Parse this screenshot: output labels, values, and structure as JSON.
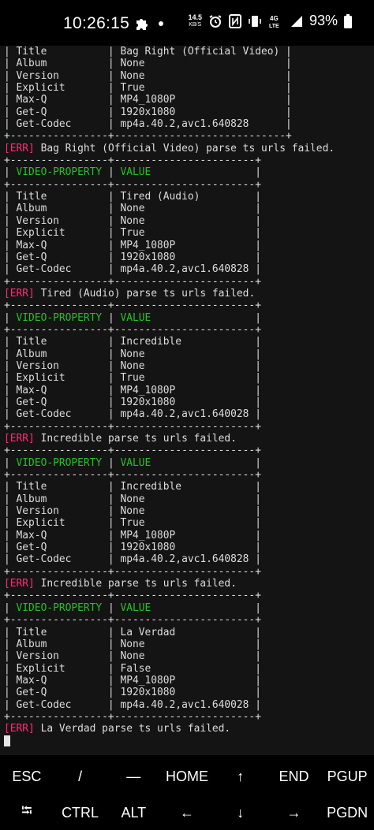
{
  "status_bar": {
    "time": "10:26:15",
    "net_speed_value": "14.5",
    "net_speed_unit": "KB/S",
    "network_type": "4G LTE",
    "battery": "93%",
    "icons": [
      "puzzle-icon",
      "dot-icon",
      "alarm-icon",
      "nfc-icon",
      "vibrate-icon",
      "signal-icon",
      "battery-icon"
    ]
  },
  "terminal": {
    "lines": [
      {
        "text": "| Title          | Bag Right (Official Video) |"
      },
      {
        "text": "| Album          | None                       |"
      },
      {
        "text": "| Version        | None                       |"
      },
      {
        "text": "| Explicit       | True                       |"
      },
      {
        "text": "| Max-Q          | MP4_1080P                  |"
      },
      {
        "text": "| Get-Q          | 1920x1080                  |"
      },
      {
        "text": "| Get-Codec      | mp4a.40.2,avc1.640828      |"
      },
      {
        "text": "+----------------+----------------------------+"
      },
      {
        "err": "[ERR]",
        "text": " Bag Right (Official Video) parse ts urls failed."
      },
      {
        "text": "+----------------+-----------------------+"
      },
      {
        "hdr": true,
        "text": "| VIDEO-PROPERTY | VALUE                 |"
      },
      {
        "text": "+----------------+-----------------------+"
      },
      {
        "text": "| Title          | Tired (Audio)         |"
      },
      {
        "text": "| Album          | None                  |"
      },
      {
        "text": "| Version        | None                  |"
      },
      {
        "text": "| Explicit       | True                  |"
      },
      {
        "text": "| Max-Q          | MP4_1080P             |"
      },
      {
        "text": "| Get-Q          | 1920x1080             |"
      },
      {
        "text": "| Get-Codec      | mp4a.40.2,avc1.640828 |"
      },
      {
        "text": "+----------------+-----------------------+"
      },
      {
        "err": "[ERR]",
        "text": " Tired (Audio) parse ts urls failed."
      },
      {
        "text": "+----------------+-----------------------+"
      },
      {
        "hdr": true,
        "text": "| VIDEO-PROPERTY | VALUE                 |"
      },
      {
        "text": "+----------------+-----------------------+"
      },
      {
        "text": "| Title          | Incredible            |"
      },
      {
        "text": "| Album          | None                  |"
      },
      {
        "text": "| Version        | None                  |"
      },
      {
        "text": "| Explicit       | True                  |"
      },
      {
        "text": "| Max-Q          | MP4_1080P             |"
      },
      {
        "text": "| Get-Q          | 1920x1080             |"
      },
      {
        "text": "| Get-Codec      | mp4a.40.2,avc1.640028 |"
      },
      {
        "text": "+----------------+-----------------------+"
      },
      {
        "err": "[ERR]",
        "text": " Incredible parse ts urls failed."
      },
      {
        "text": "+----------------+-----------------------+"
      },
      {
        "hdr": true,
        "text": "| VIDEO-PROPERTY | VALUE                 |"
      },
      {
        "text": "+----------------+-----------------------+"
      },
      {
        "text": "| Title          | Incredible            |"
      },
      {
        "text": "| Album          | None                  |"
      },
      {
        "text": "| Version        | None                  |"
      },
      {
        "text": "| Explicit       | True                  |"
      },
      {
        "text": "| Max-Q          | MP4_1080P             |"
      },
      {
        "text": "| Get-Q          | 1920x1080             |"
      },
      {
        "text": "| Get-Codec      | mp4a.40.2,avc1.640828 |"
      },
      {
        "text": "+----------------+-----------------------+"
      },
      {
        "err": "[ERR]",
        "text": " Incredible parse ts urls failed."
      },
      {
        "text": "+----------------+-----------------------+"
      },
      {
        "hdr": true,
        "text": "| VIDEO-PROPERTY | VALUE                 |"
      },
      {
        "text": "+----------------+-----------------------+"
      },
      {
        "text": "| Title          | La Verdad             |"
      },
      {
        "text": "| Album          | None                  |"
      },
      {
        "text": "| Version        | None                  |"
      },
      {
        "text": "| Explicit       | False                 |"
      },
      {
        "text": "| Max-Q          | MP4_1080P             |"
      },
      {
        "text": "| Get-Q          | 1920x1080             |"
      },
      {
        "text": "| Get-Codec      | mp4a.40.2,avc1.640028 |"
      },
      {
        "text": "+----------------+-----------------------+"
      },
      {
        "err": "[ERR]",
        "text": " La Verdad parse ts urls failed."
      }
    ]
  },
  "extra_keys": {
    "row1": [
      "ESC",
      "/",
      "—",
      "HOME",
      "↑",
      "END",
      "PGUP"
    ],
    "row2": [
      "⭾",
      "CTRL",
      "ALT",
      "←",
      "↓",
      "→",
      "PGDN"
    ]
  },
  "colors": {
    "terminal_bg": "#141414",
    "error_tag": "#ff2c75",
    "header_text": "#22c422"
  }
}
